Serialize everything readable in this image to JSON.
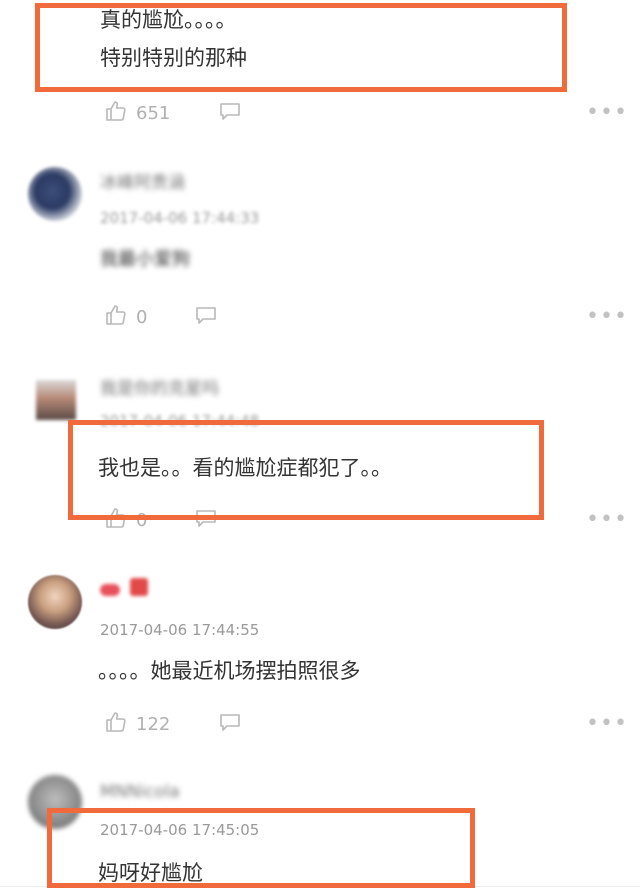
{
  "comments": [
    {
      "lines": [
        "真的尴尬。。。。",
        "特别特别的那种"
      ],
      "likes": "651"
    },
    {
      "username": "冰峰阿贵涵",
      "time": "2017-04-06 17:44:33",
      "text": "我最小爱狗",
      "likes": "0"
    },
    {
      "username": "我是你的克星吗",
      "time": "2017-04-06 17:44:48",
      "text": "我也是。。看的尴尬症都犯了。。",
      "likes": "0"
    },
    {
      "username": "",
      "time": "2017-04-06 17:44:55",
      "text": "。。。。她最近机场摆拍照很多",
      "likes": "122"
    },
    {
      "username": "MNNicola",
      "time": "2017-04-06 17:45:05",
      "text": "妈呀好尴尬"
    }
  ],
  "icons": {
    "like": "thumbs-up-icon",
    "reply": "comment-bubble-icon",
    "more": "more-dots-icon"
  },
  "colors": {
    "highlight": "#f06a3c",
    "text": "#333333",
    "meta": "#999999",
    "icon": "#c2c2c2"
  }
}
